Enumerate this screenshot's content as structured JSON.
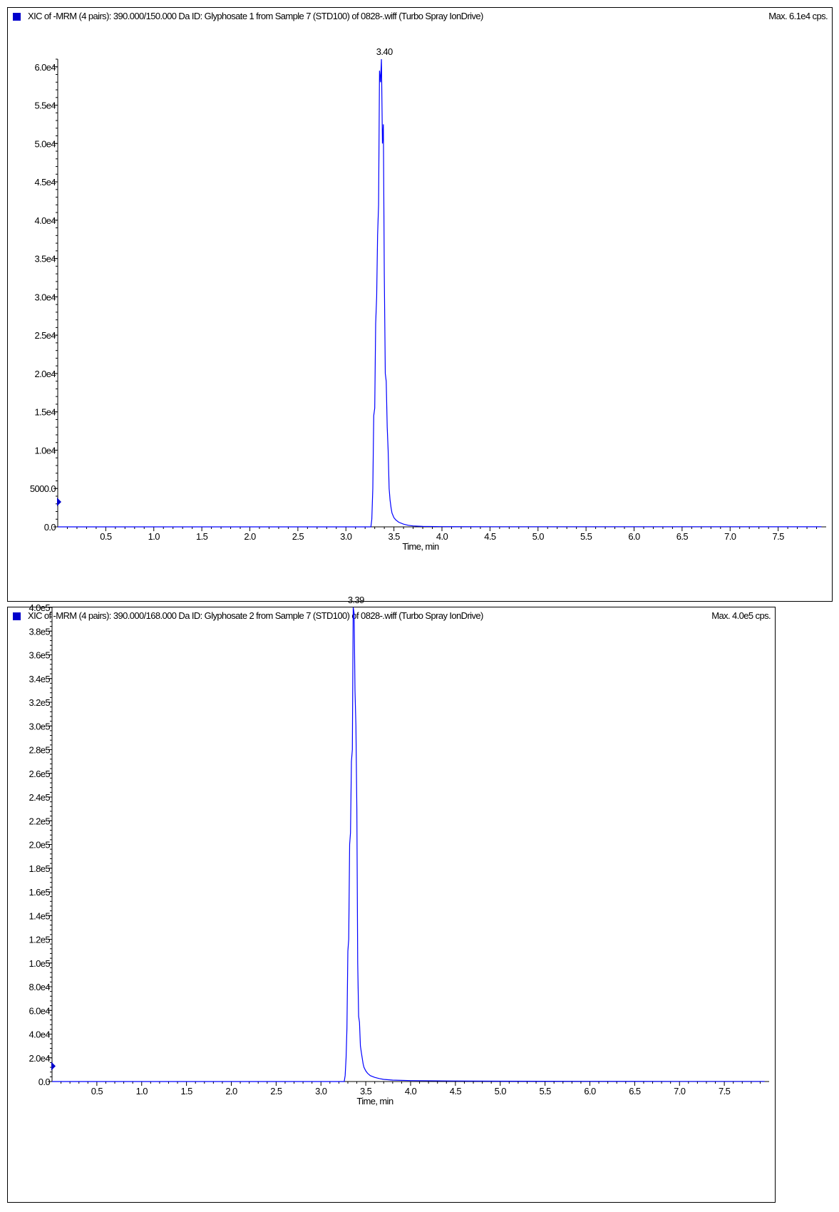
{
  "colors": {
    "trace": "#0000ff",
    "legend": "#0000cc",
    "axis": "#000000"
  },
  "panels": [
    {
      "title": "XIC of -MRM (4 pairs): 390.000/150.000 Da ID: Glyphosate 1 from Sample 7 (STD100) of 0828-.wiff (Turbo Spray IonDrive)",
      "max_label": "Max. 6.1e4 cps.",
      "peak_label": "3.40",
      "xlabel": "Time, min"
    },
    {
      "title": "XIC of -MRM (4 pairs): 390.000/168.000 Da ID: Glyphosate 2 from Sample 7 (STD100) of 0828-.wiff (Turbo Spray IonDrive)",
      "max_label": "Max. 4.0e5 cps.",
      "peak_label": "3.39",
      "xlabel": "Time, min"
    }
  ],
  "chart_data": [
    {
      "type": "line",
      "title": "XIC of -MRM (4 pairs): 390.000/150.000 Da ID: Glyphosate 1 from Sample 7 (STD100) of 0828-.wiff (Turbo Spray IonDrive)",
      "xlabel": "Time, min",
      "ylabel": "",
      "xlim": [
        0,
        8.0
      ],
      "ylim": [
        0,
        61000
      ],
      "grid": false,
      "x_ticks": [
        "0.5",
        "1.0",
        "1.5",
        "2.0",
        "2.5",
        "3.0",
        "3.5",
        "4.0",
        "4.5",
        "5.0",
        "5.5",
        "6.0",
        "6.5",
        "7.0",
        "7.5"
      ],
      "y_ticks": [
        {
          "value": 0,
          "label": "0.0"
        },
        {
          "value": 5000,
          "label": "5000.0"
        },
        {
          "value": 10000,
          "label": "1.0e4"
        },
        {
          "value": 15000,
          "label": "1.5e4"
        },
        {
          "value": 20000,
          "label": "2.0e4"
        },
        {
          "value": 25000,
          "label": "2.5e4"
        },
        {
          "value": 30000,
          "label": "3.0e4"
        },
        {
          "value": 35000,
          "label": "3.5e4"
        },
        {
          "value": 40000,
          "label": "4.0e4"
        },
        {
          "value": 45000,
          "label": "4.5e4"
        },
        {
          "value": 50000,
          "label": "5.0e4"
        },
        {
          "value": 55000,
          "label": "5.5e4"
        },
        {
          "value": 60000,
          "label": "6.0e4"
        }
      ],
      "peak": {
        "x": 3.4,
        "y": 61000,
        "label": "3.40"
      },
      "series": [
        {
          "x": [
            0,
            3.2,
            3.26,
            3.27,
            3.28,
            3.29,
            3.3,
            3.31,
            3.32,
            3.33,
            3.34,
            3.35,
            3.36,
            3.37,
            3.38,
            3.39,
            3.4,
            3.41,
            3.42,
            3.43,
            3.44,
            3.45,
            3.46,
            3.47,
            3.48,
            3.5,
            3.52,
            3.55,
            3.6,
            3.65,
            3.7,
            3.8,
            4.0,
            4.5,
            5.0,
            6.0,
            7.0,
            7.95
          ],
          "y": [
            0,
            0,
            0,
            1000,
            5000,
            14500,
            15500,
            26500,
            30000,
            38000,
            42000,
            59500,
            58000,
            61000,
            50000,
            52500,
            33000,
            20000,
            19000,
            13000,
            10000,
            5000,
            3500,
            2500,
            1800,
            1200,
            900,
            600,
            350,
            200,
            120,
            60,
            30,
            20,
            20,
            15,
            15,
            10
          ]
        }
      ]
    },
    {
      "type": "line",
      "title": "XIC of -MRM (4 pairs): 390.000/168.000 Da ID: Glyphosate 2 from Sample 7 (STD100) of 0828-.wiff (Turbo Spray IonDrive)",
      "xlabel": "Time, min",
      "ylabel": "",
      "xlim": [
        0,
        8.0
      ],
      "ylim": [
        0,
        400000
      ],
      "grid": false,
      "x_ticks": [
        "0.5",
        "1.0",
        "1.5",
        "2.0",
        "2.5",
        "3.0",
        "3.5",
        "4.0",
        "4.5",
        "5.0",
        "5.5",
        "6.0",
        "6.5",
        "7.0",
        "7.5"
      ],
      "y_ticks": [
        {
          "value": 0,
          "label": "0.0"
        },
        {
          "value": 20000,
          "label": "2.0e4"
        },
        {
          "value": 40000,
          "label": "4.0e4"
        },
        {
          "value": 60000,
          "label": "6.0e4"
        },
        {
          "value": 80000,
          "label": "8.0e4"
        },
        {
          "value": 100000,
          "label": "1.0e5"
        },
        {
          "value": 120000,
          "label": "1.2e5"
        },
        {
          "value": 140000,
          "label": "1.4e5"
        },
        {
          "value": 160000,
          "label": "1.6e5"
        },
        {
          "value": 180000,
          "label": "1.8e5"
        },
        {
          "value": 200000,
          "label": "2.0e5"
        },
        {
          "value": 220000,
          "label": "2.2e5"
        },
        {
          "value": 240000,
          "label": "2.4e5"
        },
        {
          "value": 260000,
          "label": "2.6e5"
        },
        {
          "value": 280000,
          "label": "2.8e5"
        },
        {
          "value": 300000,
          "label": "3.0e5"
        },
        {
          "value": 320000,
          "label": "3.2e5"
        },
        {
          "value": 340000,
          "label": "3.4e5"
        },
        {
          "value": 360000,
          "label": "3.6e5"
        },
        {
          "value": 380000,
          "label": "3.8e5"
        },
        {
          "value": 400000,
          "label": "4.0e5"
        }
      ],
      "peak": {
        "x": 3.39,
        "y": 400000,
        "label": "3.39"
      },
      "series": [
        {
          "x": [
            0,
            3.2,
            3.26,
            3.27,
            3.28,
            3.29,
            3.3,
            3.31,
            3.32,
            3.33,
            3.34,
            3.35,
            3.36,
            3.37,
            3.38,
            3.39,
            3.4,
            3.41,
            3.42,
            3.43,
            3.44,
            3.45,
            3.46,
            3.47,
            3.48,
            3.5,
            3.52,
            3.55,
            3.6,
            3.65,
            3.7,
            3.8,
            4.0,
            4.5,
            5.0,
            6.0,
            7.0,
            7.95
          ],
          "y": [
            0,
            0,
            0,
            5000,
            20000,
            45000,
            110000,
            120000,
            200000,
            210000,
            270000,
            280000,
            400000,
            395000,
            330000,
            300000,
            230000,
            100000,
            55000,
            50000,
            30000,
            25000,
            20000,
            15000,
            12000,
            9000,
            7000,
            5000,
            3500,
            2500,
            1800,
            1200,
            800,
            500,
            300,
            200,
            150,
            100
          ]
        }
      ]
    }
  ]
}
